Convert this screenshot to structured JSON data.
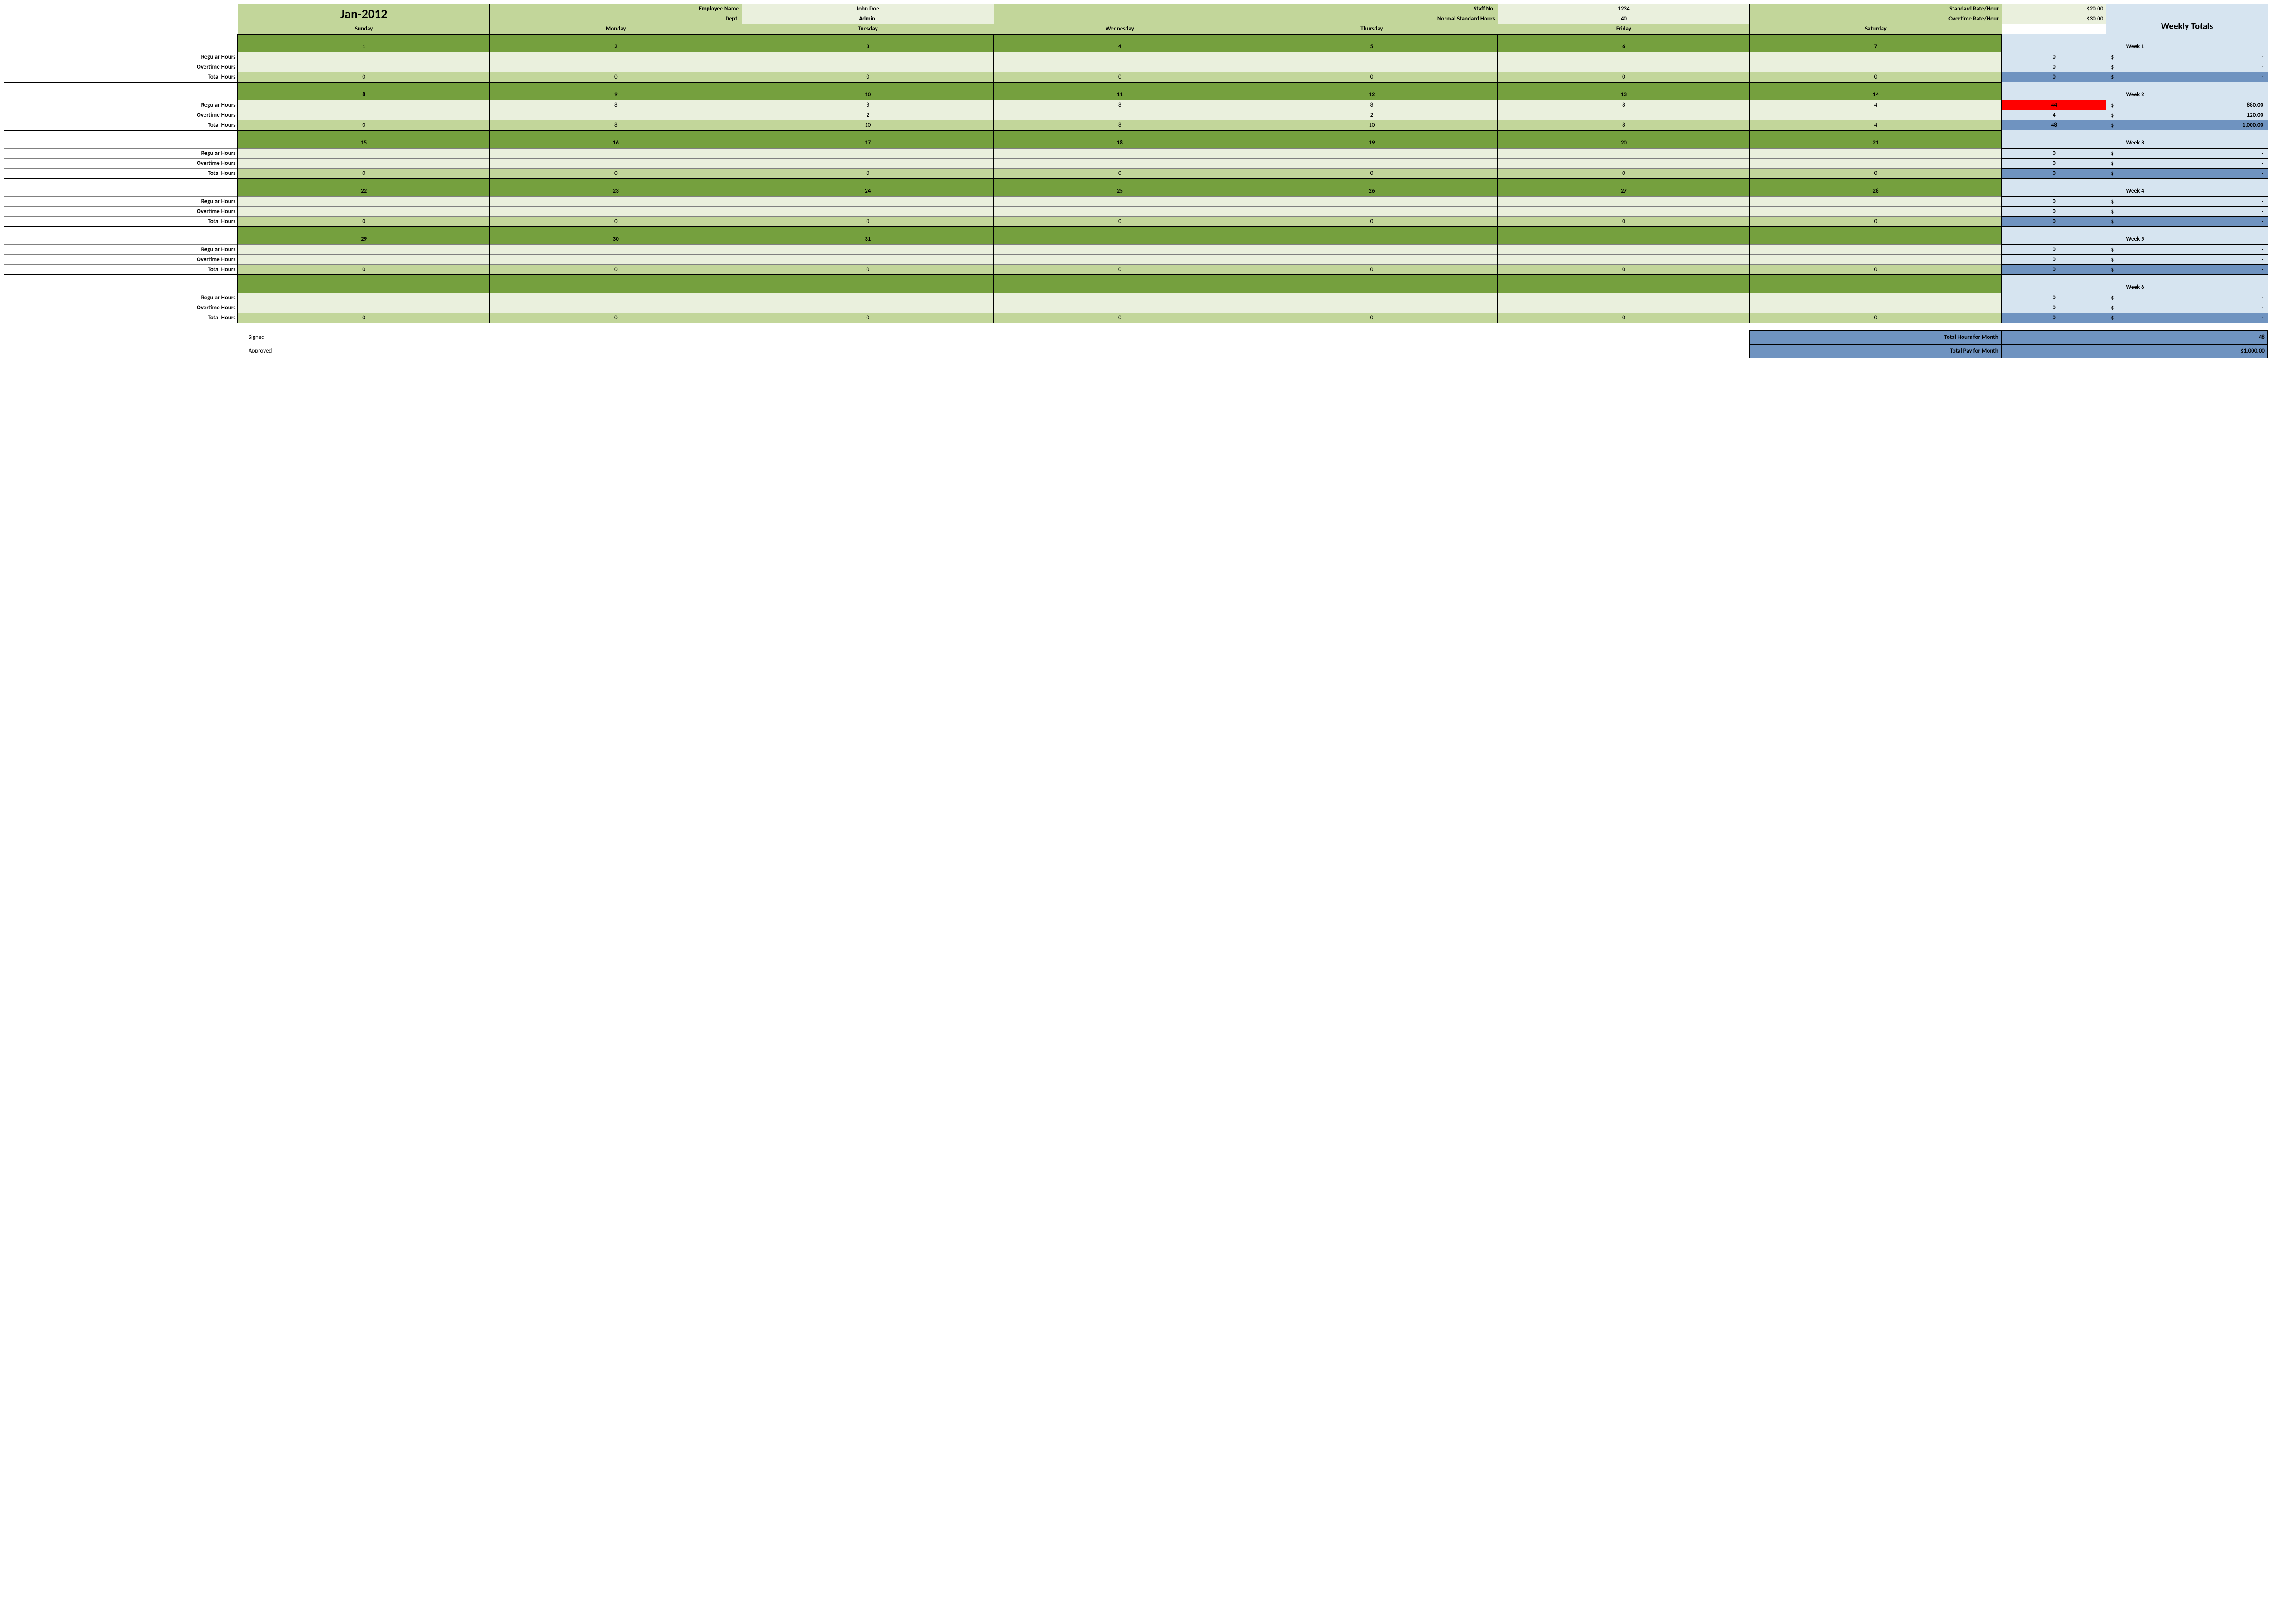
{
  "header": {
    "month": "Jan-2012",
    "employee_name_label": "Employee Name",
    "employee_name": "John Doe",
    "staff_no_label": "Staff No.",
    "staff_no": "1234",
    "std_rate_label": "Standard Rate/Hour",
    "std_rate": "$20.00",
    "dept_label": "Dept.",
    "dept": "Admin.",
    "normal_hours_label": "Normal Standard Hours",
    "normal_hours": "40",
    "ot_rate_label": "Overtime Rate/Hour",
    "ot_rate": "$30.00",
    "weekly_totals_label": "Weekly Totals"
  },
  "daynames": [
    "Sunday",
    "Monday",
    "Tuesday",
    "Wednesday",
    "Thursday",
    "Friday",
    "Saturday"
  ],
  "rowlabels": {
    "regular": "Regular Hours",
    "overtime": "Overtime Hours",
    "total": "Total Hours"
  },
  "weeks": [
    {
      "label": "Week 1",
      "days": [
        "1",
        "2",
        "3",
        "4",
        "5",
        "6",
        "7"
      ],
      "regular": [
        "",
        "",
        "",
        "",
        "",
        "",
        ""
      ],
      "overtime": [
        "",
        "",
        "",
        "",
        "",
        "",
        ""
      ],
      "total": [
        "0",
        "0",
        "0",
        "0",
        "0",
        "0",
        "0"
      ],
      "wk_reg_h": "0",
      "wk_reg_amt_sym": "$",
      "wk_reg_amt_val": "-",
      "wk_ot_h": "0",
      "wk_ot_amt_sym": "$",
      "wk_ot_amt_val": "-",
      "wk_tot_h": "0",
      "wk_tot_amt_sym": "$",
      "wk_tot_amt_val": "-",
      "reg_highlight": false
    },
    {
      "label": "Week 2",
      "days": [
        "8",
        "9",
        "10",
        "11",
        "12",
        "13",
        "14"
      ],
      "regular": [
        "",
        "8",
        "8",
        "8",
        "8",
        "8",
        "4"
      ],
      "overtime": [
        "",
        "",
        "2",
        "",
        "2",
        "",
        ""
      ],
      "total": [
        "0",
        "8",
        "10",
        "8",
        "10",
        "8",
        "4"
      ],
      "wk_reg_h": "44",
      "wk_reg_amt_sym": "$",
      "wk_reg_amt_val": "880.00",
      "wk_ot_h": "4",
      "wk_ot_amt_sym": "$",
      "wk_ot_amt_val": "120.00",
      "wk_tot_h": "48",
      "wk_tot_amt_sym": "$",
      "wk_tot_amt_val": "1,000.00",
      "reg_highlight": true
    },
    {
      "label": "Week 3",
      "days": [
        "15",
        "16",
        "17",
        "18",
        "19",
        "20",
        "21"
      ],
      "regular": [
        "",
        "",
        "",
        "",
        "",
        "",
        ""
      ],
      "overtime": [
        "",
        "",
        "",
        "",
        "",
        "",
        ""
      ],
      "total": [
        "0",
        "0",
        "0",
        "0",
        "0",
        "0",
        "0"
      ],
      "wk_reg_h": "0",
      "wk_reg_amt_sym": "$",
      "wk_reg_amt_val": "-",
      "wk_ot_h": "0",
      "wk_ot_amt_sym": "$",
      "wk_ot_amt_val": "-",
      "wk_tot_h": "0",
      "wk_tot_amt_sym": "$",
      "wk_tot_amt_val": "-",
      "reg_highlight": false
    },
    {
      "label": "Week 4",
      "days": [
        "22",
        "23",
        "24",
        "25",
        "26",
        "27",
        "28"
      ],
      "regular": [
        "",
        "",
        "",
        "",
        "",
        "",
        ""
      ],
      "overtime": [
        "",
        "",
        "",
        "",
        "",
        "",
        ""
      ],
      "total": [
        "0",
        "0",
        "0",
        "0",
        "0",
        "0",
        "0"
      ],
      "wk_reg_h": "0",
      "wk_reg_amt_sym": "$",
      "wk_reg_amt_val": "-",
      "wk_ot_h": "0",
      "wk_ot_amt_sym": "$",
      "wk_ot_amt_val": "-",
      "wk_tot_h": "0",
      "wk_tot_amt_sym": "$",
      "wk_tot_amt_val": "-",
      "reg_highlight": false
    },
    {
      "label": "Week 5",
      "days": [
        "29",
        "30",
        "31",
        "",
        "",
        "",
        ""
      ],
      "regular": [
        "",
        "",
        "",
        "",
        "",
        "",
        ""
      ],
      "overtime": [
        "",
        "",
        "",
        "",
        "",
        "",
        ""
      ],
      "total": [
        "0",
        "0",
        "0",
        "0",
        "0",
        "0",
        "0"
      ],
      "wk_reg_h": "0",
      "wk_reg_amt_sym": "$",
      "wk_reg_amt_val": "-",
      "wk_ot_h": "0",
      "wk_ot_amt_sym": "$",
      "wk_ot_amt_val": "-",
      "wk_tot_h": "0",
      "wk_tot_amt_sym": "$",
      "wk_tot_amt_val": "-",
      "reg_highlight": false
    },
    {
      "label": "Week 6",
      "days": [
        "",
        "",
        "",
        "",
        "",
        "",
        ""
      ],
      "regular": [
        "",
        "",
        "",
        "",
        "",
        "",
        ""
      ],
      "overtime": [
        "",
        "",
        "",
        "",
        "",
        "",
        ""
      ],
      "total": [
        "0",
        "0",
        "0",
        "0",
        "0",
        "0",
        "0"
      ],
      "wk_reg_h": "0",
      "wk_reg_amt_sym": "$",
      "wk_reg_amt_val": "-",
      "wk_ot_h": "0",
      "wk_ot_amt_sym": "$",
      "wk_ot_amt_val": "-",
      "wk_tot_h": "0",
      "wk_tot_amt_sym": "$",
      "wk_tot_amt_val": "-",
      "reg_highlight": false
    }
  ],
  "footer": {
    "signed_label": "Signed",
    "approved_label": "Approved",
    "total_hours_label": "Total Hours for Month",
    "total_hours_val": "48",
    "total_pay_label": "Total Pay for Month",
    "total_pay_val": "$1,000.00"
  }
}
